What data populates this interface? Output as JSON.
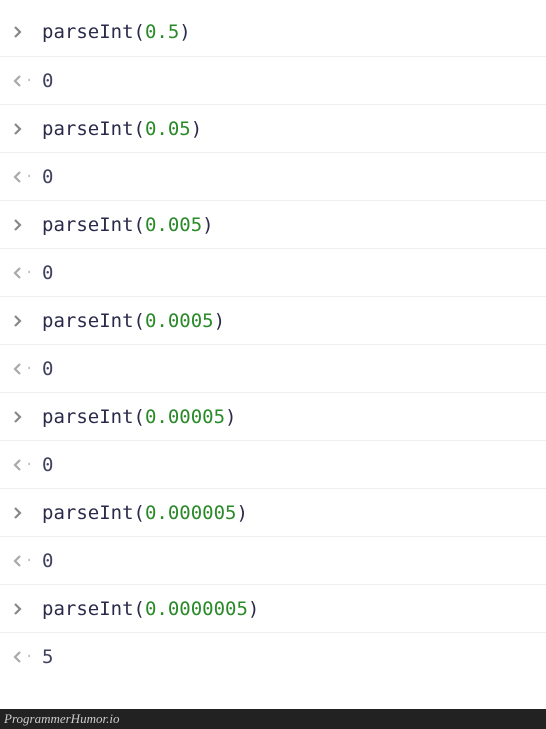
{
  "entries": [
    {
      "func": "parseInt",
      "arg": "0.5",
      "result": "0"
    },
    {
      "func": "parseInt",
      "arg": "0.05",
      "result": "0"
    },
    {
      "func": "parseInt",
      "arg": "0.005",
      "result": "0"
    },
    {
      "func": "parseInt",
      "arg": "0.0005",
      "result": "0"
    },
    {
      "func": "parseInt",
      "arg": "0.00005",
      "result": "0"
    },
    {
      "func": "parseInt",
      "arg": "0.000005",
      "result": "0"
    },
    {
      "func": "parseInt",
      "arg": "0.0000005",
      "result": "5"
    }
  ],
  "footer": "ProgrammerHumor.io"
}
